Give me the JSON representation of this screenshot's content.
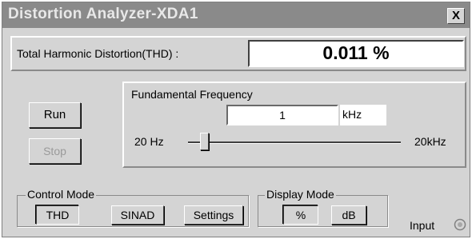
{
  "window": {
    "title": "Distortion Analyzer-XDA1",
    "close_label": "X"
  },
  "thd": {
    "label": "Total Harmonic Distortion(THD) :",
    "value": "0.011 %"
  },
  "buttons": {
    "run": "Run",
    "stop": "Stop"
  },
  "frequency": {
    "label": "Fundamental Frequency",
    "value": "1",
    "unit": "kHz",
    "slider_min_label": "20 Hz",
    "slider_max_label": "20kHz"
  },
  "control_mode": {
    "label": "Control Mode",
    "options": [
      "THD",
      "SINAD",
      "Settings"
    ],
    "selected": "THD"
  },
  "display_mode": {
    "label": "Display Mode",
    "options": [
      "%",
      "dB"
    ],
    "selected": "%"
  },
  "input": {
    "label": "Input"
  }
}
